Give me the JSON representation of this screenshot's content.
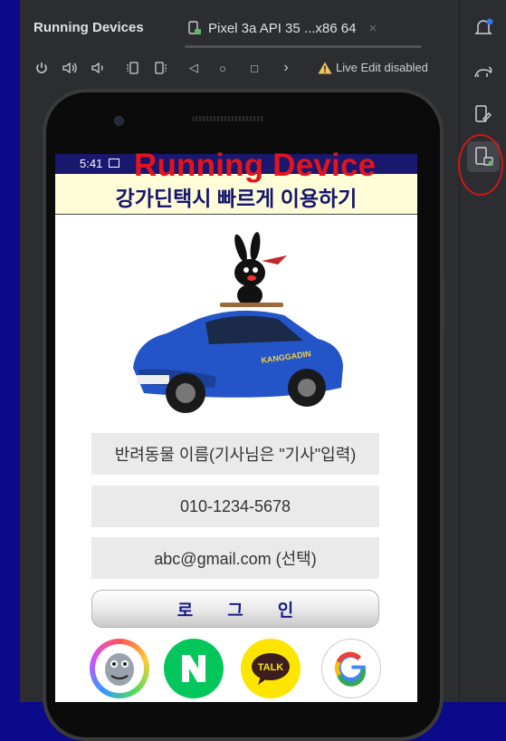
{
  "ide": {
    "panel_title": "Running Devices",
    "device_tab_label": "Pixel 3a API 35 ...x86 64",
    "tab_close": "×",
    "toolbar": {
      "power": "⏻",
      "volume_up": "🔊",
      "volume_down": "🔉",
      "rotate_left": "⟲",
      "rotate_right": "⟳",
      "back": "◁",
      "home": "○",
      "overview": "□",
      "more": "›",
      "live_edit_label": "Live Edit disabled"
    },
    "right_strip_icons": [
      "notifications-icon",
      "gradle-icon",
      "device-manager-icon",
      "running-devices-icon"
    ]
  },
  "annotation": {
    "label": "Running Device",
    "color": "#e3141d"
  },
  "phone": {
    "status_time": "5:41",
    "app": {
      "title": "강가딘택시 빠르게 이용하기",
      "pet_name_placeholder": "반려동물 이름(기사님은 \"기사\"입력)",
      "phone_placeholder": "010-1234-5678",
      "email_placeholder": "abc@gmail.com (선택)",
      "login_label": "로그인",
      "car_text": "KANGGADIN",
      "social": [
        {
          "name": "profile",
          "label": ""
        },
        {
          "name": "naver",
          "label": "N"
        },
        {
          "name": "kakao",
          "label": "TALK"
        },
        {
          "name": "google",
          "label": "G"
        }
      ]
    }
  },
  "colors": {
    "background": "#0a0a8a",
    "ide_panel": "#2b2d30",
    "status_bar": "#17186e",
    "header_bg": "#fffcd8",
    "title_color": "#15156e",
    "naver": "#03c75a",
    "kakao": "#fee500",
    "circle_highlight": "#d01818"
  }
}
